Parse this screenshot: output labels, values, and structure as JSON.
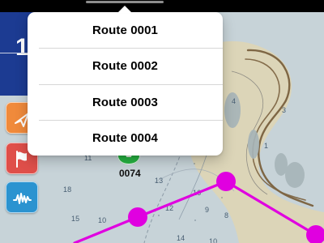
{
  "status_bar": {
    "color": "#000000"
  },
  "left_panel": {
    "value": "1",
    "color": "#1c3b92"
  },
  "tools": [
    {
      "name": "navigation-arrow-icon",
      "color": "#f08a3b"
    },
    {
      "name": "flag-icon",
      "color": "#df4f4a"
    },
    {
      "name": "waveform-icon",
      "color": "#2b93d0"
    }
  ],
  "route_menu": {
    "items": [
      {
        "label": "Route 0001"
      },
      {
        "label": "Route 0002"
      },
      {
        "label": "Route 0003"
      },
      {
        "label": "Route 0004"
      }
    ],
    "background": "#ffffff",
    "separator_color": "#d7d7d7"
  },
  "map": {
    "waypoint_label": "0074",
    "route_color": "#e000e0",
    "water_color": "#c7d3d8",
    "land_color": "#ddd4b6",
    "depth_labels": [
      "18",
      "11",
      "15",
      "10",
      "13",
      "12",
      "16",
      "14",
      "9",
      "8",
      "4",
      "1",
      "10",
      "14",
      "3"
    ]
  }
}
